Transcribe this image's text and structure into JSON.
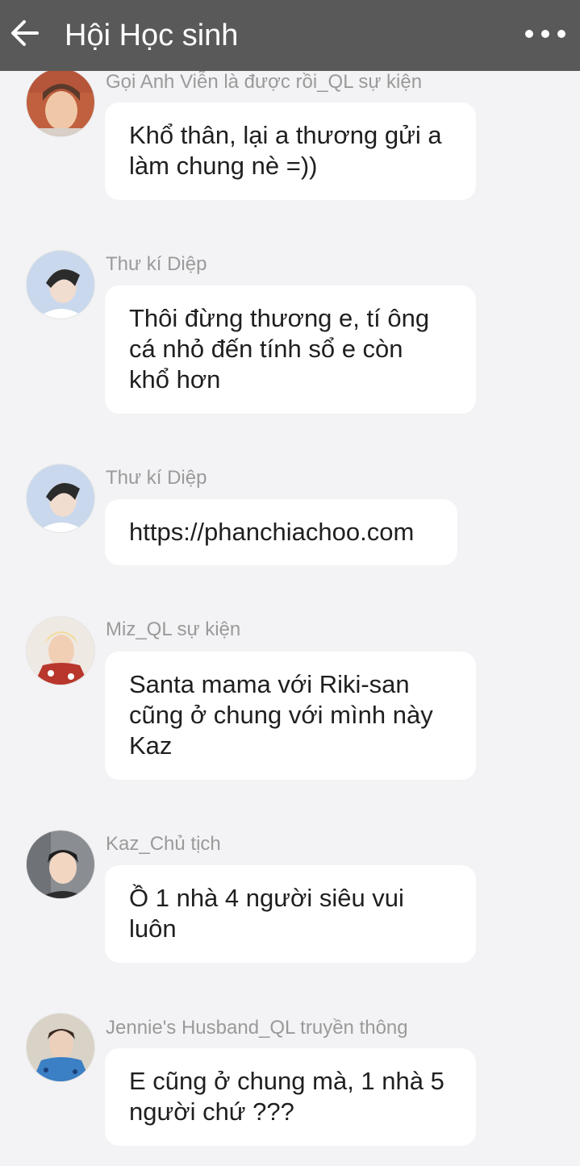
{
  "header": {
    "title": "Hội Học sinh",
    "back_icon": "arrow-left-icon",
    "more_icon": "more-horizontal-icon"
  },
  "messages": [
    {
      "sender": "Gọi Anh Viễn là được rồi_QL sự kiện",
      "text": "Khổ thân, lại a thương gửi a\nlàm chung nè =))"
    },
    {
      "sender": "Thư kí Diệp",
      "text": "Thôi đừng thương e, tí ông\ncá nhỏ đến tính sổ e còn\nkhổ hơn"
    },
    {
      "sender": "Thư kí Diệp",
      "text": "https://phanchiachoo.com"
    },
    {
      "sender": "Miz_QL sự kiện",
      "text": "Santa mama với Riki-san\ncũng ở chung với mình này\nKaz"
    },
    {
      "sender": "Kaz_Chủ tịch",
      "text": "Ồ 1 nhà 4 người siêu vui\nluôn"
    },
    {
      "sender": "Jennie's Husband_QL truyền thông",
      "text": "E cũng ở chung mà, 1 nhà 5\nngười chứ ???"
    }
  ]
}
